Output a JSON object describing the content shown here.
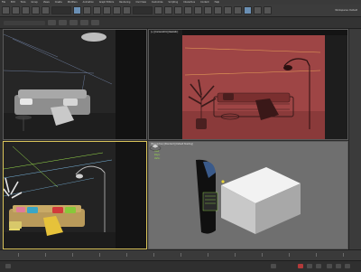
{
  "menu": [
    "File",
    "Edit",
    "Tools",
    "Group",
    "Views",
    "Create",
    "Modifiers",
    "Animation",
    "Graph Editors",
    "Rendering",
    "Civil View",
    "Customize",
    "Scripting",
    "Interactive",
    "Content",
    "Help"
  ],
  "workspace": "Workspaces: Default",
  "viewports": {
    "top_left": {
      "label": ""
    },
    "top_right": {
      "label": "[+] [Camera001] [Realistic]"
    },
    "bottom_left": {
      "label": ""
    },
    "bottom_right": {
      "label": "[Perspective] [Standard] [Default Shading]"
    }
  },
  "stats": {
    "line1": "Total",
    "line2": "Polys:",
    "line3": "Verts:"
  },
  "colors": {
    "accent": "#6a8fb4",
    "render_red": "#9e4545",
    "selection": "#d9c35a"
  }
}
